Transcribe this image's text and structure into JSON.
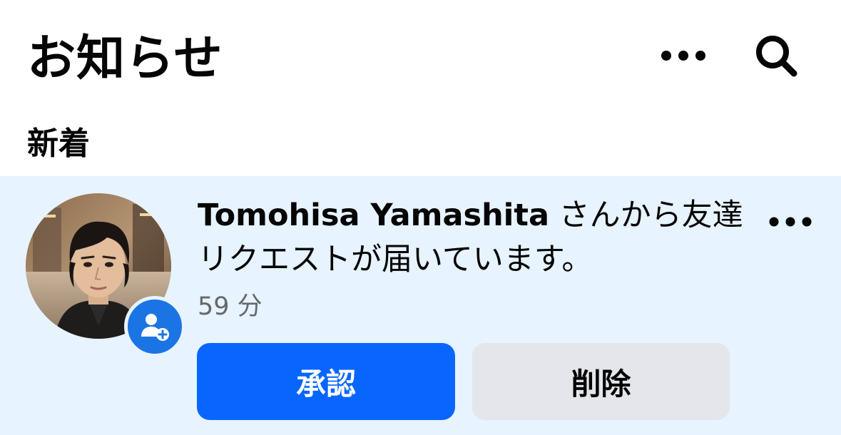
{
  "header": {
    "title": "お知らせ",
    "more_icon": "more-horizontal-icon",
    "search_icon": "search-icon"
  },
  "section": {
    "heading": "新着"
  },
  "notification": {
    "sender_name": "Tomohisa Yamashita",
    "message_suffix": " さんから友達リクエストが届いています。",
    "time": "59 分",
    "avatar_icon": "profile-photo",
    "badge_icon": "friend-request-icon",
    "more_icon": "more-horizontal-icon",
    "confirm_label": "承認",
    "delete_label": "削除"
  },
  "colors": {
    "accent": "#0866ff",
    "badge": "#1b74e4",
    "unread_background": "#e7f3ff",
    "secondary_button": "#e4e6eb",
    "secondary_text": "#65676b"
  }
}
